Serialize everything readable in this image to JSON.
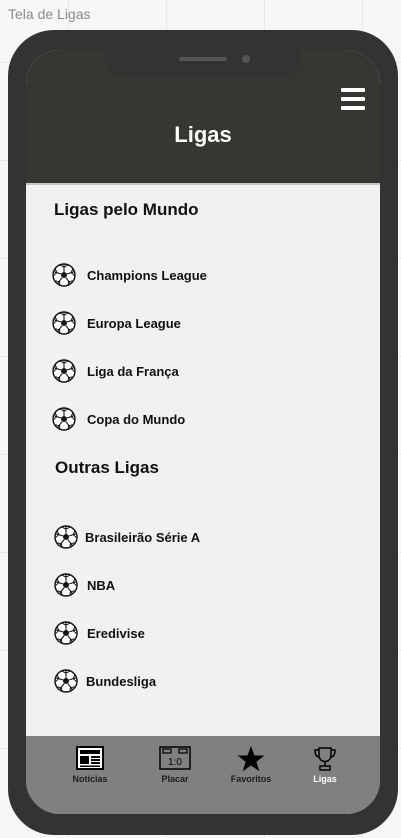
{
  "canvas": {
    "title": "Tela de Ligas"
  },
  "header": {
    "title": "Ligas",
    "menu_icon": "hamburger-menu-icon"
  },
  "sections": [
    {
      "title": "Ligas pelo Mundo",
      "items": [
        {
          "label": "Champions League",
          "icon": "soccer-ball-icon"
        },
        {
          "label": "Europa League",
          "icon": "soccer-ball-icon"
        },
        {
          "label": "Liga da França",
          "icon": "soccer-ball-icon"
        },
        {
          "label": "Copa do Mundo",
          "icon": "soccer-ball-icon"
        }
      ]
    },
    {
      "title": "Outras Ligas",
      "items": [
        {
          "label": "Brasileirão Série A",
          "icon": "soccer-ball-icon"
        },
        {
          "label": "NBA",
          "icon": "soccer-ball-icon"
        },
        {
          "label": "Eredivise",
          "icon": "soccer-ball-icon"
        },
        {
          "label": "Bundesliga",
          "icon": "soccer-ball-icon"
        }
      ]
    }
  ],
  "tabbar": {
    "tabs": [
      {
        "label": "Notícias",
        "icon": "newspaper-icon",
        "active": false
      },
      {
        "label": "Placar",
        "icon": "scoreboard-icon",
        "active": false,
        "score": "1:0"
      },
      {
        "label": "Favoritos",
        "icon": "star-icon",
        "active": false
      },
      {
        "label": "Ligas",
        "icon": "trophy-icon",
        "active": true
      }
    ]
  },
  "colors": {
    "header_bg": "#373732",
    "content_bg": "#f2f0f1",
    "tabbar_bg": "#808080",
    "phone_frame": "#333333",
    "active_tab_text": "#ffffff"
  }
}
